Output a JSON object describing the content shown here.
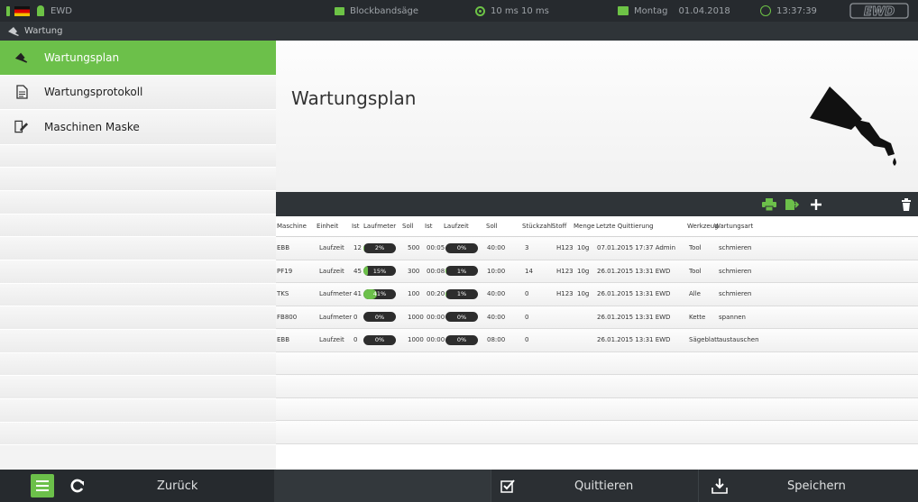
{
  "topbar": {
    "user": "EWD",
    "machine": "Blockbandsäge",
    "cycle": "10 ms  10 ms",
    "day": "Montag",
    "date": "01.04.2018",
    "time": "13:37:39",
    "logo": "EWD",
    "accent": "#6cc04a"
  },
  "breadcrumb": {
    "label": "Wartung"
  },
  "sidebar": {
    "items": [
      {
        "label": "Wartungsplan",
        "icon": "maintenance-icon",
        "active": true
      },
      {
        "label": "Wartungsprotokoll",
        "icon": "document-icon",
        "active": false
      },
      {
        "label": "Maschinen Maske",
        "icon": "edit-document-icon",
        "active": false
      }
    ]
  },
  "main": {
    "title": "Wartungsplan",
    "big_icon": "oil-can-icon"
  },
  "toolbar": {
    "icons": [
      "print-icon",
      "export-icon",
      "add-icon",
      "delete-icon"
    ]
  },
  "table": {
    "headers": [
      "Maschine",
      "Einheit",
      "Ist",
      "Laufmeter",
      "Soll",
      "Ist",
      "Laufzeit",
      "Soll",
      "Stückzahl",
      "Stoff",
      "Menge",
      "Letzte Quittierung",
      "Werkzeug",
      "Wartungsart"
    ],
    "rows": [
      {
        "maschine": "EBB",
        "einheit": "Laufzeit",
        "ist1": "12",
        "laufmeter_pct": 0.02,
        "laufmeter": "2%",
        "soll1": "500",
        "ist2": "00:05",
        "laufzeit_pct": 0.0,
        "laufzeit": "0%",
        "soll2": "40:00",
        "stueck": "3",
        "stoff": "H123",
        "menge": "10g",
        "letzte": "07.01.2015 17:37 Admin",
        "werkzeug": "Tool",
        "art": "schmieren"
      },
      {
        "maschine": "PF19",
        "einheit": "Laufzeit",
        "ist1": "45",
        "laufmeter_pct": 0.15,
        "laufmeter": "15%",
        "soll1": "300",
        "ist2": "00:08",
        "laufzeit_pct": 0.01,
        "laufzeit": "1%",
        "soll2": "10:00",
        "stueck": "14",
        "stoff": "H123",
        "menge": "10g",
        "letzte": "26.01.2015 13:31 EWD",
        "werkzeug": "Tool",
        "art": "schmieren"
      },
      {
        "maschine": "TKS",
        "einheit": "Laufmeter",
        "ist1": "41",
        "laufmeter_pct": 0.41,
        "laufmeter": "41%",
        "soll1": "100",
        "ist2": "00:20",
        "laufzeit_pct": 0.01,
        "laufzeit": "1%",
        "soll2": "40:00",
        "stueck": "0",
        "stoff": "H123",
        "menge": "10g",
        "letzte": "26.01.2015 13:31 EWD",
        "werkzeug": "Alle",
        "art": "schmieren"
      },
      {
        "maschine": "FB800",
        "einheit": "Laufmeter",
        "ist1": "0",
        "laufmeter_pct": 0.0,
        "laufmeter": "0%",
        "soll1": "1000",
        "ist2": "00:00",
        "laufzeit_pct": 0.0,
        "laufzeit": "0%",
        "soll2": "40:00",
        "stueck": "0",
        "stoff": "",
        "menge": "",
        "letzte": "26.01.2015 13:31 EWD",
        "werkzeug": "Kette",
        "art": "spannen"
      },
      {
        "maschine": "EBB",
        "einheit": "Laufzeit",
        "ist1": "0",
        "laufmeter_pct": 0.0,
        "laufmeter": "0%",
        "soll1": "1000",
        "ist2": "00:00",
        "laufzeit_pct": 0.0,
        "laufzeit": "0%",
        "soll2": "08:00",
        "stueck": "0",
        "stoff": "",
        "menge": "",
        "letzte": "26.01.2015 13:31 EWD",
        "werkzeug": "Sägeblatt",
        "art": "austauschen"
      }
    ]
  },
  "bottom": {
    "back_label": "Zurück",
    "confirm_label": "Quittieren",
    "save_label": "Speichern"
  }
}
